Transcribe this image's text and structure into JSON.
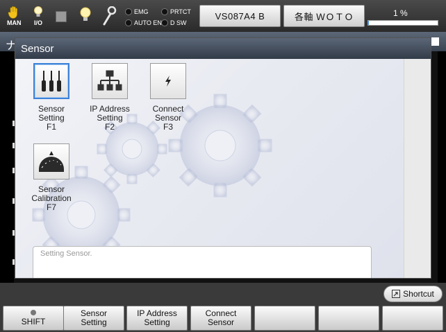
{
  "topbar": {
    "mode_label": "MAN",
    "io_label": "I/O",
    "indicators": [
      "EMG",
      "PRTCT",
      "AUTO EN",
      "D SW"
    ],
    "program_button": "VS087A4 B",
    "axis_button": "各軸 ＷＯＴＯ",
    "speed_percent": "1 %",
    "speed_fraction": 0.01
  },
  "dialog": {
    "title": "Sensor",
    "tiles": [
      {
        "label": "Sensor\nSetting",
        "key": "F1"
      },
      {
        "label": "IP Address\nSetting",
        "key": "F2"
      },
      {
        "label": "Connect\nSensor",
        "key": "F3"
      },
      {
        "label": "Sensor\nCalibration",
        "key": "F7"
      }
    ],
    "description": "Setting Sensor."
  },
  "bottom": {
    "shortcut_label": "Shortcut",
    "fkeys": [
      "SHIFT",
      "Sensor\nSetting",
      "IP Address\nSetting",
      "Connect\nSensor",
      "",
      "",
      ""
    ]
  },
  "behind": {
    "fragment": "ナ"
  },
  "colors": {
    "accent": "#3c82d8",
    "title_bar": "#3a4452"
  }
}
